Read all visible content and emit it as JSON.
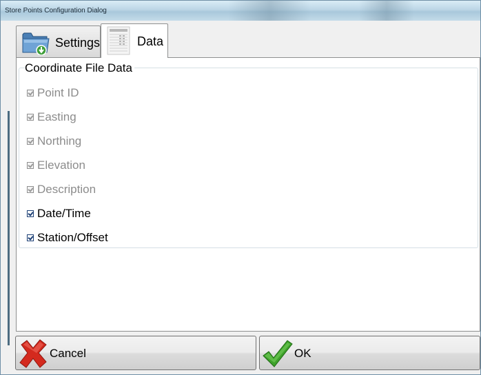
{
  "window": {
    "title": "Store Points Configuration Dialog"
  },
  "tabs": [
    {
      "label": "Settings",
      "icon": "folder-download-icon",
      "selected": false
    },
    {
      "label": "Data",
      "icon": "document-table-icon",
      "selected": true
    }
  ],
  "group": {
    "title": "Coordinate File Data",
    "items": [
      {
        "label": "Point ID",
        "checked": true,
        "enabled": false
      },
      {
        "label": "Easting",
        "checked": true,
        "enabled": false
      },
      {
        "label": "Northing",
        "checked": true,
        "enabled": false
      },
      {
        "label": "Elevation",
        "checked": true,
        "enabled": false
      },
      {
        "label": "Description",
        "checked": true,
        "enabled": false
      },
      {
        "label": "Date/Time",
        "checked": true,
        "enabled": true
      },
      {
        "label": "Station/Offset",
        "checked": true,
        "enabled": true
      }
    ]
  },
  "buttons": {
    "cancel": {
      "label": "Cancel",
      "icon": "red-x-icon"
    },
    "ok": {
      "label": "OK",
      "icon": "green-checkmark-icon"
    }
  },
  "colors": {
    "disabled_text": "#8c8c8c",
    "checkbox_enabled": "#1c3f75",
    "cancel_icon": "#d42a1e",
    "ok_icon": "#3da12a"
  }
}
